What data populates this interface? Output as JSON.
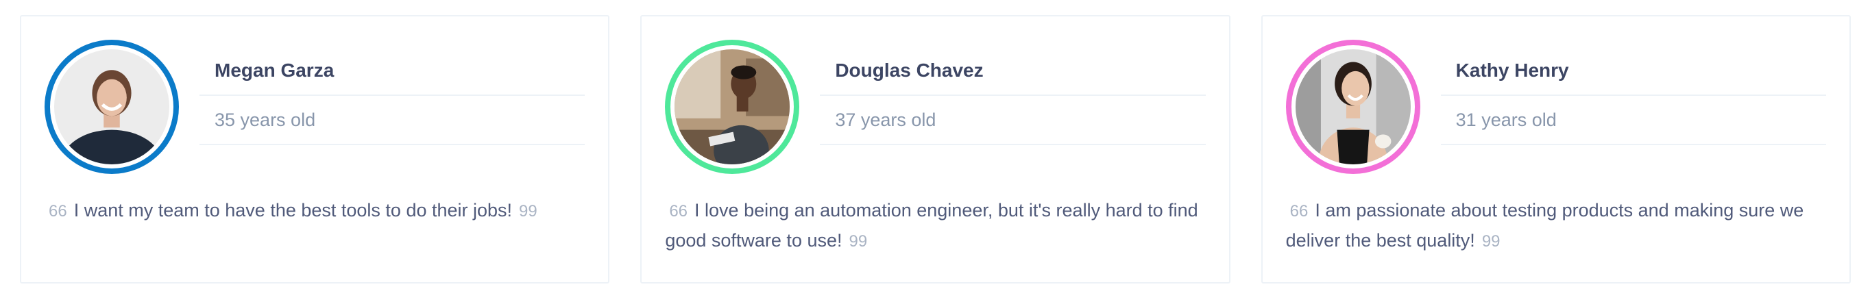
{
  "colors": {
    "card_border": "#edf2f7",
    "name": "#3c4563",
    "age": "#8896ab",
    "quote": "#505a7a",
    "quote_marks": "#aab4c4"
  },
  "testimonials": [
    {
      "name": "Megan Garza",
      "age": "35 years old",
      "open_mark": "66",
      "quote": "I want my team to have the best tools to do their jobs!",
      "close_mark": "99",
      "ring_color": "#0b7bc9",
      "photo_icon": "portrait-woman-smiling-icon"
    },
    {
      "name": "Douglas Chavez",
      "age": "37 years old",
      "open_mark": "66",
      "quote": "I love being an automation engineer, but it's really hard to find good software to use!",
      "close_mark": "99",
      "ring_color": "#4ee89a",
      "photo_icon": "portrait-man-working-icon"
    },
    {
      "name": "Kathy Henry",
      "age": "31 years old",
      "open_mark": "66",
      "quote": "I am passionate about testing products and making sure we deliver the best quality!",
      "close_mark": "99",
      "ring_color": "#f36fd7",
      "photo_icon": "portrait-woman-laughing-icon"
    }
  ]
}
